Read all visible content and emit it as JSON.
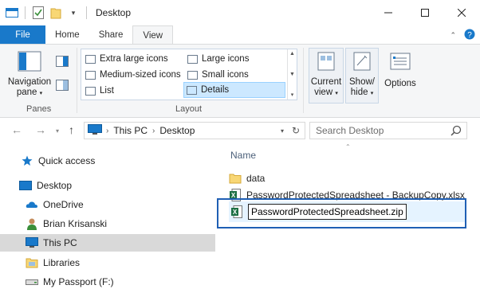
{
  "window": {
    "title": "Desktop"
  },
  "tabs": {
    "file": "File",
    "home": "Home",
    "share": "Share",
    "view": "View"
  },
  "ribbon": {
    "panes": {
      "nav_line1": "Navigation",
      "nav_line2": "pane",
      "group": "Panes"
    },
    "layout": {
      "group": "Layout",
      "items": [
        "Extra large icons",
        "Large icons",
        "Medium-sized icons",
        "Small icons",
        "List",
        "Details"
      ],
      "selected": "Details"
    },
    "current_view": {
      "line1": "Current",
      "line2": "view"
    },
    "show_hide": {
      "line1": "Show/",
      "line2": "hide"
    },
    "options": "Options"
  },
  "address": {
    "segments": [
      "This PC",
      "Desktop"
    ]
  },
  "search": {
    "placeholder": "Search Desktop"
  },
  "nav": {
    "items": [
      "Quick access",
      "Desktop",
      "OneDrive",
      "Brian Krisanski",
      "This PC",
      "Libraries",
      "My Passport (F:)"
    ],
    "selected": "This PC"
  },
  "files": {
    "column": "Name",
    "rows": [
      "data",
      "PasswordProtectedSpreadsheet - BackupCopy.xlsx"
    ],
    "rename_value": "PasswordProtectedSpreadsheet.zip"
  },
  "colors": {
    "accent": "#1979ca",
    "highlight_border": "#1f5fb4",
    "selection": "#cce8ff"
  }
}
